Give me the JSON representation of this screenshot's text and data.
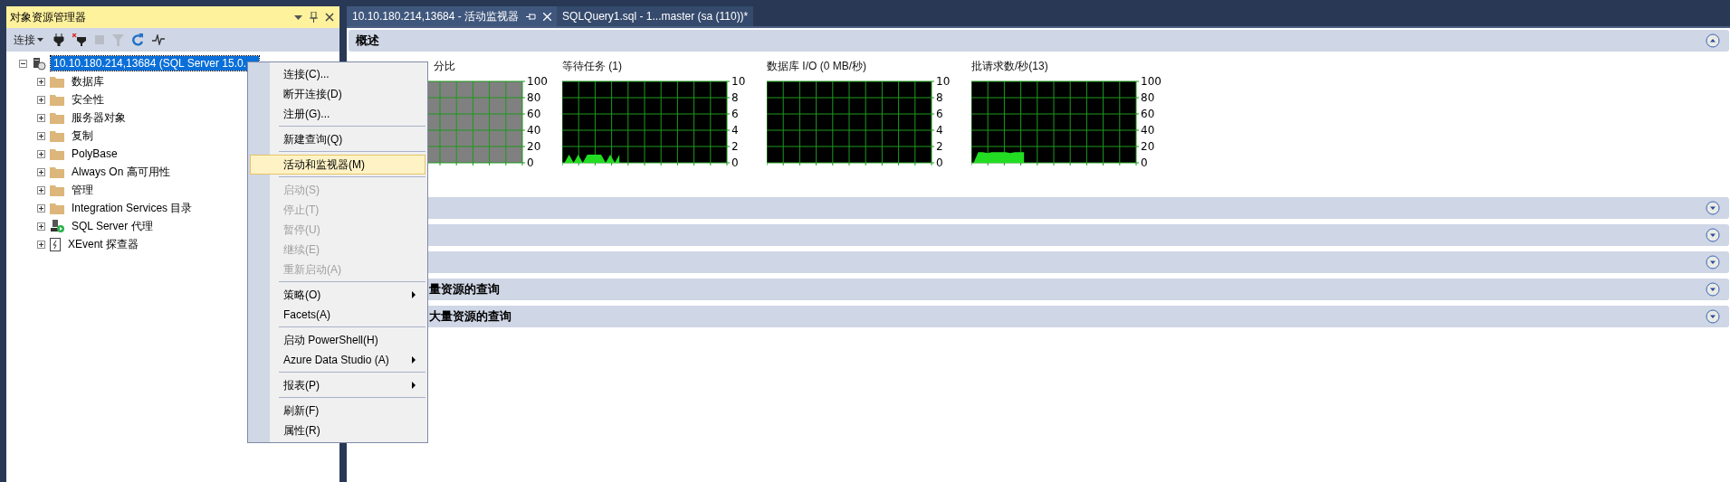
{
  "explorer": {
    "title": "对象资源管理器",
    "connect_label": "连接",
    "tree": {
      "label": "10.10.180.214,13684 (SQL Server 15.0.",
      "expanded": true,
      "selected": true,
      "kind": "server",
      "children": [
        {
          "label": "数据库",
          "kind": "folder",
          "expanded": false,
          "selected": false
        },
        {
          "label": "安全性",
          "kind": "folder",
          "expanded": false,
          "selected": false
        },
        {
          "label": "服务器对象",
          "kind": "folder",
          "expanded": false,
          "selected": false
        },
        {
          "label": "复制",
          "kind": "folder",
          "expanded": false,
          "selected": false
        },
        {
          "label": "PolyBase",
          "kind": "folder",
          "expanded": false,
          "selected": false
        },
        {
          "label": "Always On 高可用性",
          "kind": "folder",
          "expanded": false,
          "selected": false
        },
        {
          "label": "管理",
          "kind": "folder",
          "expanded": false,
          "selected": false
        },
        {
          "label": "Integration Services 目录",
          "kind": "folder",
          "expanded": false,
          "selected": false
        },
        {
          "label": "SQL Server 代理",
          "kind": "agent",
          "expanded": false,
          "selected": false
        },
        {
          "label": "XEvent 探查器",
          "kind": "xevent",
          "expanded": false,
          "selected": false
        }
      ]
    }
  },
  "tabs": [
    {
      "label": "10.10.180.214,13684 - 活动监视器",
      "selected": true
    },
    {
      "label": "SQLQuery1.sql - 1...master (sa (110))*",
      "selected": false
    }
  ],
  "sections": [
    {
      "title": "概述",
      "expanded": true,
      "cut_off": false,
      "charts": [
        {
          "cut_off": true,
          "disabled": true,
          "chart_data": {
            "type": "area",
            "title": "分比",
            "grid": true,
            "categories": [
              null,
              null,
              null,
              null,
              null,
              null,
              null,
              null,
              null,
              null,
              null,
              null,
              null,
              null,
              null,
              null,
              null,
              null,
              null,
              null,
              null,
              null,
              null,
              null,
              null,
              null,
              null,
              null,
              null,
              null,
              null,
              null,
              null,
              null,
              null,
              null
            ],
            "ylim": [
              0,
              100
            ],
            "yticks": [
              0,
              20,
              40,
              60,
              80,
              100
            ]
          }
        },
        {
          "cut_off": false,
          "disabled": false,
          "chart_data": {
            "type": "area",
            "title": "等待任务 (1)",
            "grid": true,
            "categories": [
              null,
              null,
              null,
              null,
              null,
              null,
              null,
              null,
              null,
              null,
              null,
              null,
              null,
              null,
              null,
              null,
              null,
              null,
              null,
              null,
              null,
              null,
              null,
              null,
              null,
              null,
              null,
              null,
              null,
              null,
              null,
              null,
              null,
              null,
              null,
              null
            ],
            "ylim": [
              0,
              10
            ],
            "yticks": [
              0,
              2,
              4,
              6,
              8,
              10
            ],
            "series": [
              {
                "color": "#22dd22",
                "values": [
                  0,
                  1,
                  0,
                  1,
                  0,
                  1,
                  1,
                  1,
                  1,
                  0,
                  1,
                  0,
                  1,
                  null,
                  null,
                  null,
                  null,
                  null,
                  null,
                  null,
                  null,
                  null,
                  null,
                  null,
                  null,
                  null,
                  null,
                  null,
                  null,
                  null,
                  null,
                  null,
                  null,
                  null,
                  null,
                  null
                ]
              }
            ]
          }
        },
        {
          "cut_off": false,
          "disabled": false,
          "chart_data": {
            "type": "area",
            "title": "数据库 I/O (0 MB/秒)",
            "grid": true,
            "categories": [
              null,
              null,
              null,
              null,
              null,
              null,
              null,
              null,
              null,
              null,
              null,
              null,
              null,
              null,
              null,
              null,
              null,
              null,
              null,
              null,
              null,
              null,
              null,
              null,
              null,
              null,
              null,
              null,
              null,
              null,
              null,
              null,
              null,
              null,
              null,
              null
            ],
            "ylim": [
              0,
              10
            ],
            "yticks": [
              0,
              2,
              4,
              6,
              8,
              10
            ]
          }
        },
        {
          "cut_off": false,
          "disabled": false,
          "chart_data": {
            "type": "area",
            "title": "批请求数/秒(13)",
            "grid": true,
            "categories": [
              null,
              null,
              null,
              null,
              null,
              null,
              null,
              null,
              null,
              null,
              null,
              null,
              null,
              null,
              null,
              null,
              null,
              null,
              null,
              null,
              null,
              null,
              null,
              null,
              null,
              null,
              null,
              null,
              null,
              null,
              null,
              null,
              null,
              null,
              null,
              null
            ],
            "ylim": [
              0,
              100
            ],
            "yticks": [
              0,
              20,
              40,
              60,
              80,
              100
            ],
            "series": [
              {
                "color": "#22dd22",
                "values": [
                  0,
                  13,
                  13,
                  12,
                  13,
                  13,
                  13,
                  13,
                  12,
                  13,
                  13,
                  13,
                  null,
                  null,
                  null,
                  null,
                  null,
                  null,
                  null,
                  null,
                  null,
                  null,
                  null,
                  null,
                  null,
                  null,
                  null,
                  null,
                  null,
                  null,
                  null,
                  null,
                  null,
                  null,
                  null,
                  null
                ]
              }
            ]
          }
        }
      ]
    },
    {
      "expanded": false
    },
    {
      "expanded": false
    },
    {
      "expanded": false
    },
    {
      "title": "量资源的查询",
      "expanded": false,
      "cut_off": true
    },
    {
      "title": "大量资源的查询",
      "expanded": false,
      "cut_off": true
    }
  ],
  "context_menu": {
    "groups": [
      [
        {
          "label": "连接(C)...",
          "disabled": false,
          "selected": false,
          "submenu": false
        },
        {
          "label": "断开连接(D)",
          "disabled": false,
          "selected": false,
          "submenu": false
        },
        {
          "label": "注册(G)...",
          "disabled": false,
          "selected": false,
          "submenu": false
        }
      ],
      [
        {
          "label": "新建查询(Q)",
          "disabled": false,
          "selected": false,
          "submenu": false
        }
      ],
      [
        {
          "label": "活动和监视器(M)",
          "disabled": false,
          "selected": true,
          "submenu": false
        }
      ],
      [
        {
          "label": "启动(S)",
          "disabled": true,
          "selected": false,
          "submenu": false
        },
        {
          "label": "停止(T)",
          "disabled": true,
          "selected": false,
          "submenu": false
        },
        {
          "label": "暂停(U)",
          "disabled": true,
          "selected": false,
          "submenu": false
        },
        {
          "label": "继续(E)",
          "disabled": true,
          "selected": false,
          "submenu": false
        },
        {
          "label": "重新启动(A)",
          "disabled": true,
          "selected": false,
          "submenu": false
        }
      ],
      [
        {
          "label": "策略(O)",
          "disabled": false,
          "selected": false,
          "submenu": true
        },
        {
          "label": "Facets(A)",
          "disabled": false,
          "selected": false,
          "submenu": false
        }
      ],
      [
        {
          "label": "启动 PowerShell(H)",
          "disabled": false,
          "selected": false,
          "submenu": false
        },
        {
          "label": "Azure Data Studio (A)",
          "disabled": false,
          "selected": false,
          "submenu": true
        }
      ],
      [
        {
          "label": "报表(P)",
          "disabled": false,
          "selected": false,
          "submenu": true
        }
      ],
      [
        {
          "label": "刷新(F)",
          "disabled": false,
          "selected": false,
          "submenu": false
        },
        {
          "label": "属性(R)",
          "disabled": false,
          "selected": false,
          "submenu": false
        }
      ]
    ]
  }
}
